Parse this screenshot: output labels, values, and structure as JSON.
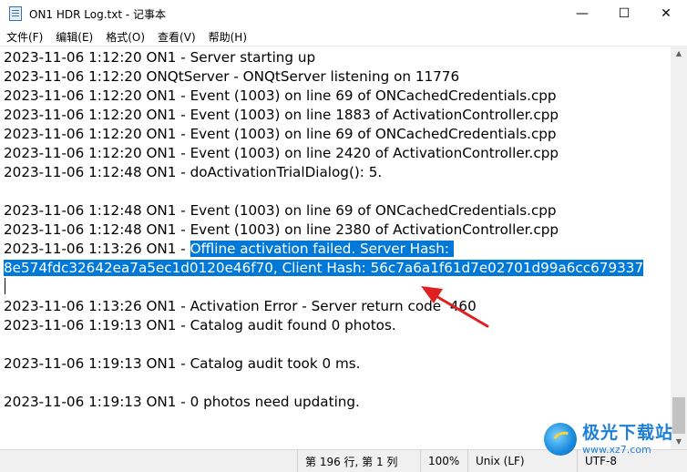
{
  "window": {
    "title": "ON1 HDR Log.txt - 记事本",
    "controls": {
      "minimize": "—",
      "maximize": "☐",
      "close": "✕"
    }
  },
  "menu": {
    "items": [
      "文件(F)",
      "编辑(E)",
      "格式(O)",
      "查看(V)",
      "帮助(H)"
    ]
  },
  "editor": {
    "lines": [
      {
        "text": "2023-11-06 1:12:20 ON1 - Server starting up"
      },
      {
        "text": "2023-11-06 1:12:20 ONQtServer - ONQtServer listening on 11776"
      },
      {
        "text": "2023-11-06 1:12:20 ON1 - Event (1003) on line 69 of ONCachedCredentials.cpp"
      },
      {
        "text": "2023-11-06 1:12:20 ON1 - Event (1003) on line 1883 of ActivationController.cpp"
      },
      {
        "text": "2023-11-06 1:12:20 ON1 - Event (1003) on line 69 of ONCachedCredentials.cpp"
      },
      {
        "text": "2023-11-06 1:12:20 ON1 - Event (1003) on line 2420 of ActivationController.cpp"
      },
      {
        "text": "2023-11-06 1:12:48 ON1 - doActivationTrialDialog(): 5."
      },
      {
        "text": ""
      },
      {
        "text": "2023-11-06 1:12:48 ON1 - Event (1003) on line 69 of ONCachedCredentials.cpp"
      },
      {
        "text": "2023-11-06 1:12:48 ON1 - Event (1003) on line 2380 of ActivationController.cpp"
      },
      {
        "text": "2023-11-06 1:13:26 ON1 - ",
        "selected": "Offline activation failed. Server Hash: "
      },
      {
        "text": "",
        "selected": "8e574fdc32642ea7a5ec1d0120e46f70, Client Hash: 56c7a6a1f61d7e02701d99a6cc679337"
      },
      {
        "text": ""
      },
      {
        "text": "2023-11-06 1:13:26 ON1 - Activation Error - Server return code  460"
      },
      {
        "text": "2023-11-06 1:19:13 ON1 - Catalog audit found 0 photos."
      },
      {
        "text": ""
      },
      {
        "text": "2023-11-06 1:19:13 ON1 - Catalog audit took 0 ms."
      },
      {
        "text": ""
      },
      {
        "text": "2023-11-06 1:19:13 ON1 - 0 photos need updating."
      }
    ]
  },
  "status": {
    "position": "第 196 行, 第 1 列",
    "zoom": "100%",
    "line_ending": "Unix (LF)",
    "encoding": "UTF-8"
  },
  "watermark": {
    "title": "极光下载站",
    "url": "www.xz7.com"
  },
  "annotation": {
    "arrow_color": "#e02020"
  }
}
